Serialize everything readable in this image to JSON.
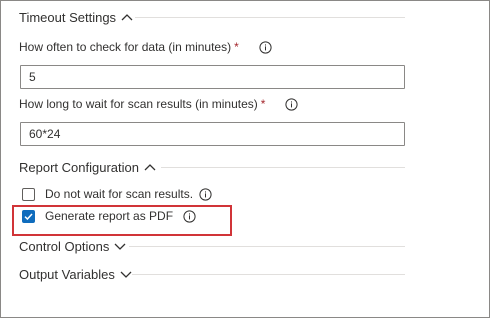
{
  "sections": {
    "timeout": {
      "title": "Timeout Settings",
      "chevron": "chevron-up-icon"
    },
    "report": {
      "title": "Report Configuration",
      "chevron": "chevron-up-icon"
    },
    "control": {
      "title": "Control Options",
      "chevron": "chevron-down-icon"
    },
    "output": {
      "title": "Output Variables",
      "chevron": "chevron-down-icon"
    }
  },
  "fields": {
    "check_interval": {
      "label": "How often to check for data (in minutes)",
      "required_mark": "*",
      "value": "5"
    },
    "scan_wait": {
      "label": "How long to wait for scan results (in minutes)",
      "required_mark": "*",
      "value": "60*24"
    }
  },
  "checkboxes": {
    "no_wait": {
      "label": "Do not wait for scan results.",
      "checked": false
    },
    "pdf": {
      "label": "Generate report as PDF",
      "checked": true
    }
  },
  "colors": {
    "accent": "#0f6cbd",
    "highlight": "#d13438",
    "required": "#a4262c",
    "text": "#323130"
  }
}
